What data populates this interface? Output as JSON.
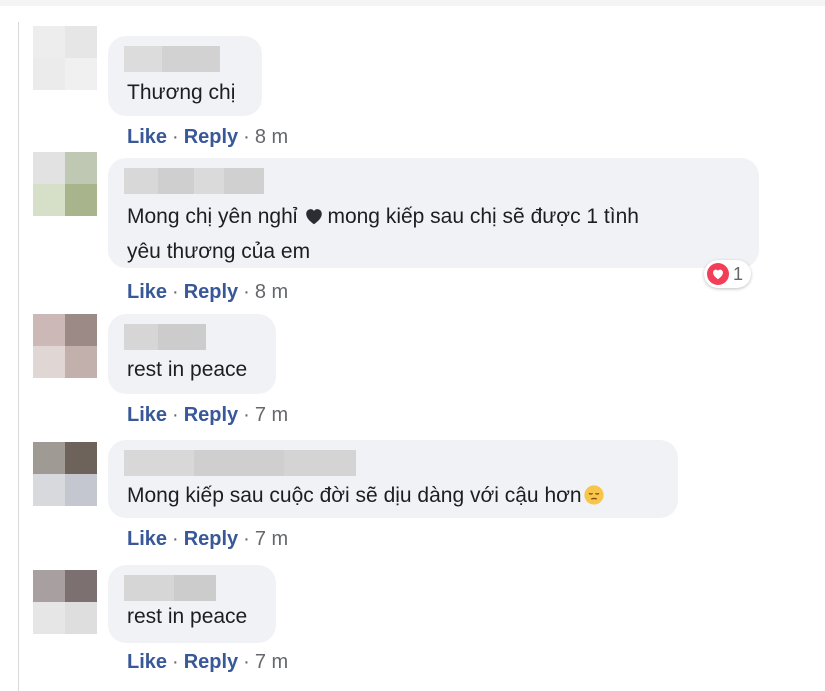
{
  "comments": [
    {
      "text_lines": [
        "Thương chị"
      ],
      "like": "Like",
      "reply": "Reply",
      "separator": "·",
      "time": "8 m"
    },
    {
      "text_lines": [
        "Mong chị yên nghỉ",
        "mong kiếp sau chị sẽ được 1 tình",
        "yêu thương của em"
      ],
      "inline_icon": "black-heart-icon",
      "reaction": {
        "icon": "heart-reaction-icon",
        "count": "1",
        "color": "#f33e58"
      },
      "like": "Like",
      "reply": "Reply",
      "separator": "·",
      "time": "8 m"
    },
    {
      "text_lines": [
        "rest in peace"
      ],
      "like": "Like",
      "reply": "Reply",
      "separator": "·",
      "time": "7 m"
    },
    {
      "text_lines": [
        "Mong kiếp sau cuộc đời sẽ dịu dàng với cậu hơn"
      ],
      "inline_icon": "pensive-face-emoji",
      "like": "Like",
      "reply": "Reply",
      "separator": "·",
      "time": "7 m"
    },
    {
      "text_lines": [
        "rest in peace"
      ],
      "like": "Like",
      "reply": "Reply",
      "separator": "·",
      "time": "7 m"
    }
  ],
  "colors": {
    "link": "#385898",
    "bubble": "#f0f2f5",
    "text": "#1c1e21",
    "meta": "#65676b"
  }
}
